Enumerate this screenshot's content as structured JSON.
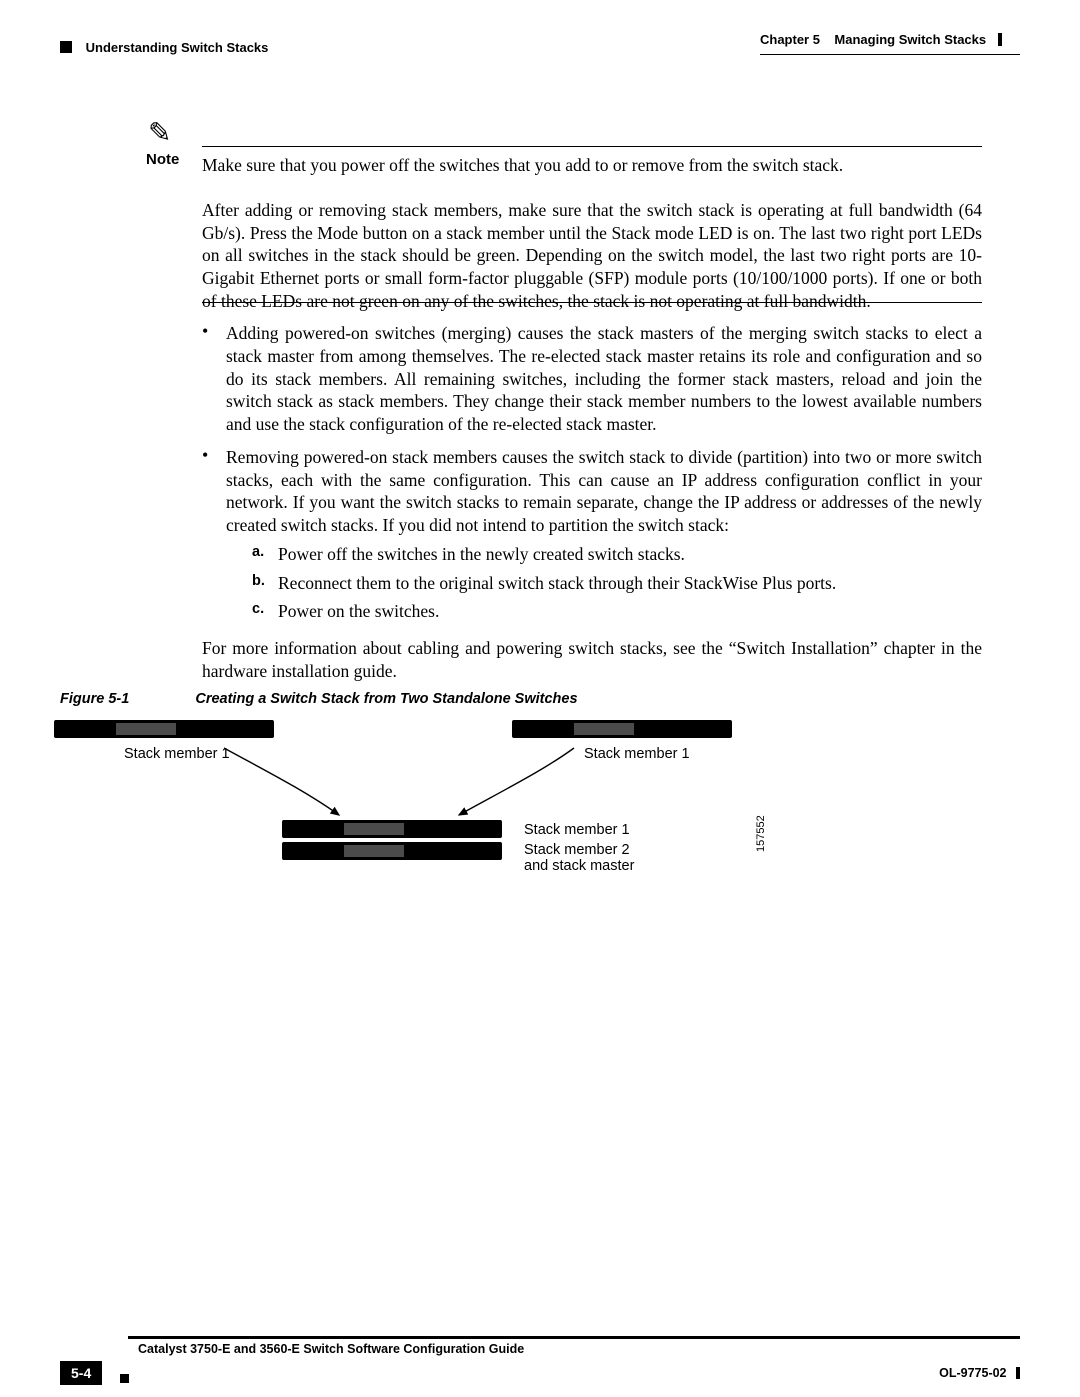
{
  "header": {
    "left": "Understanding Switch Stacks",
    "rightChapter": "Chapter 5",
    "rightTitle": "Managing Switch Stacks"
  },
  "note": {
    "label": "Note",
    "line": "Make sure that you power off the switches that you add to or remove from the switch stack.",
    "para": "After adding or removing stack members, make sure that the switch stack is operating at full bandwidth (64 Gb/s). Press the Mode button on a stack member until the Stack mode LED is on. The last two right port LEDs on all switches in the stack should be green. Depending on the switch model, the last two right ports are 10-Gigabit Ethernet ports or small form-factor pluggable (SFP) module ports (10/100/1000 ports). If one or both of these LEDs are not green on any of the switches, the stack is not operating at full bandwidth."
  },
  "bullets": {
    "b1": "Adding powered-on switches (merging) causes the stack masters of the merging switch stacks to elect a stack master from among themselves. The re-elected stack master retains its role and configuration and so do its stack members. All remaining switches, including the former stack masters, reload and join the switch stack as stack members. They change their stack member numbers to the lowest available numbers and use the stack configuration of the re-elected stack master.",
    "b2": "Removing powered-on stack members causes the switch stack to divide (partition) into two or more switch stacks, each with the same configuration. This can cause an IP address configuration conflict in your network. If you want the switch stacks to remain separate, change the IP address or addresses of the newly created switch stacks. If you did not intend to partition the switch stack:",
    "sa": "Power off the switches in the newly created switch stacks.",
    "sb": "Reconnect them to the original switch stack through their StackWise Plus ports.",
    "sc": "Power on the switches.",
    "after": "For more information about cabling and powering switch stacks, see the “Switch Installation” chapter in the hardware installation guide."
  },
  "figure": {
    "num": "Figure 5-1",
    "title": "Creating a Switch Stack from Two Standalone Switches",
    "leftLabel": "Stack member 1",
    "rightLabel": "Stack member 1",
    "stackTop": "Stack member 1",
    "stackBot": "Stack member 2\nand stack master",
    "code": "157552"
  },
  "footer": {
    "guide": "Catalyst 3750-E and 3560-E Switch Software Configuration Guide",
    "page": "5-4",
    "doc": "OL-9775-02"
  }
}
